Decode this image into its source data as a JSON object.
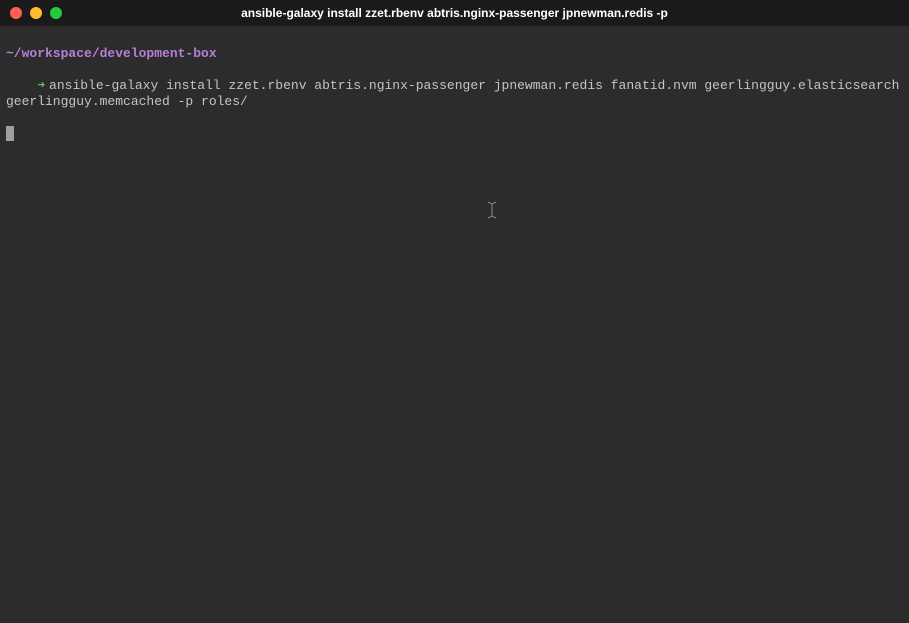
{
  "window": {
    "title": "ansible-galaxy install zzet.rbenv abtris.nginx-passenger jpnewman.redis -p"
  },
  "terminal": {
    "cwd": "~/workspace/development-box",
    "prompt_arrow": "➜",
    "command": "ansible-galaxy install zzet.rbenv abtris.nginx-passenger jpnewman.redis fanatid.nvm geerlingguy.elasticsearch geerlingguy.memcached -p roles/"
  }
}
